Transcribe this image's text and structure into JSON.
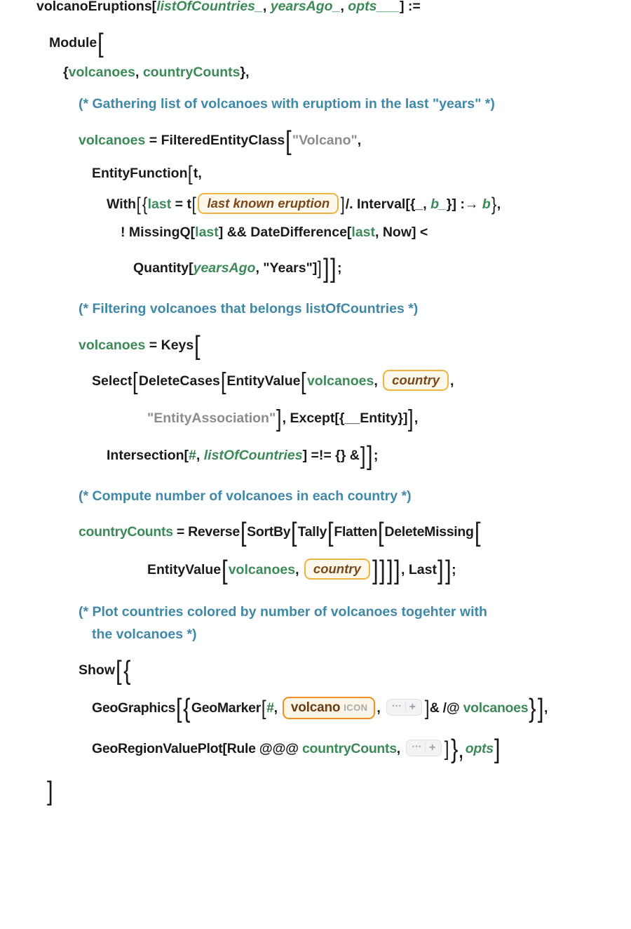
{
  "language": "Wolfram Language",
  "colors": {
    "symbol": "#1a1a1a",
    "local_variable": "#3b8a57",
    "pattern_variable": "#3b8a57",
    "string": "#8c8c8c",
    "comment": "#3f88a8",
    "entity_box_bg": "#fdf8ec",
    "entity_box_border": "#edb441",
    "entity_box_text": "#7a4718",
    "icon_box_border": "#ef8e21",
    "icon_box_text": "#6b3d11",
    "icon_kind_label": "#a9a9a9",
    "summary_button_bg": "#f2f3f5"
  },
  "code": {
    "definition_name": "volcanoEruptions",
    "line1": {
      "head": "volcanoEruptions[",
      "arg1": "listOfCountries_",
      "sep1": ", ",
      "arg2": "yearsAgo_",
      "sep2": ", ",
      "arg3": "opts___",
      "close": "] :="
    },
    "line2": {
      "head": "Module"
    },
    "line3": {
      "open": "{",
      "var1": "volcanoes",
      "sep": ", ",
      "var2": "countryCounts",
      "close": "},"
    },
    "comment1": "(* Gathering list of volcanoes with eruptiom in the last \"years\" *)",
    "line4": {
      "lhs": "volcanoes",
      "assign": " = ",
      "fn": "FilteredEntityClass",
      "arg": "\"Volcano\"",
      "trail": ","
    },
    "line5": {
      "fn": "EntityFunction",
      "arg": "t,"
    },
    "line6": {
      "fn": "With",
      "open_brace": "{",
      "var": "last",
      "assign": " = ",
      "part": "t",
      "entity_box": "last known eruption",
      "replace": "/. Interval[{_, ",
      "b_": "b_",
      "mid": "}] :→ ",
      "b": "b",
      "close": "},"
    },
    "line7": {
      "not": "! MissingQ[",
      "last1": "last",
      "and": "] && DateDifference[",
      "last2": "last",
      "now": ", Now] <"
    },
    "line8": {
      "fn": "Quantity[",
      "arg1": "yearsAgo",
      "arg2": ", \"Years\"]",
      "close": ";"
    },
    "comment2": "(* Filtering volcanoes that belongs listOfCountries *)",
    "line9": {
      "lhs": "volcanoes",
      "assign": " = ",
      "fn": "Keys"
    },
    "line10": {
      "select": "Select",
      "deletecases": "DeleteCases",
      "entityvalue": "EntityValue",
      "arg1": "volcanoes",
      "sep": ", ",
      "entity_box": "country",
      "trail": ","
    },
    "line11": {
      "str": "\"EntityAssociation\"",
      "mid": ", Except[{__Entity}]",
      "trail": ","
    },
    "line12": {
      "fn": "Intersection[",
      "slot": "#",
      "sep": ", ",
      "arg": "listOfCountries",
      "cmp": "] =!= {} &",
      "close": ";"
    },
    "comment3": "(* Compute number of volcanoes in each country *)",
    "line13": {
      "lhs": "countryCounts",
      "assign": " = ",
      "f1": "Reverse",
      "f2": "SortBy",
      "f3": "Tally",
      "f4": "Flatten",
      "f5": "DeleteMissing"
    },
    "line14": {
      "fn": "EntityValue",
      "arg1": "volcanoes",
      "sep": ", ",
      "entity_box": "country",
      "tail": ", Last",
      "close": ";"
    },
    "comment4_line1": "(* Plot countries colored by number of volcanoes togehter with",
    "comment4_line2": "the volcanoes *)",
    "line15": {
      "fn": "Show",
      "open": "{"
    },
    "line16": {
      "fn": "GeoGraphics",
      "open": "{",
      "marker": "GeoMarker",
      "slot": "#",
      "sep": ", ",
      "icon_name": "volcano",
      "icon_kind": "ICON",
      "sep2": ", ",
      "apply": "& /@ ",
      "arg": "volcanoes",
      "close": "},"
    },
    "line17": {
      "fn": "GeoRegionValuePlot[Rule @@@ ",
      "arg": "countryCounts",
      "sep": ", ",
      "close_brace": "}, ",
      "opts": "opts"
    },
    "line18": {
      "close": "]"
    }
  },
  "icons": {
    "summary_dots": "⋯",
    "summary_plus": "+"
  }
}
